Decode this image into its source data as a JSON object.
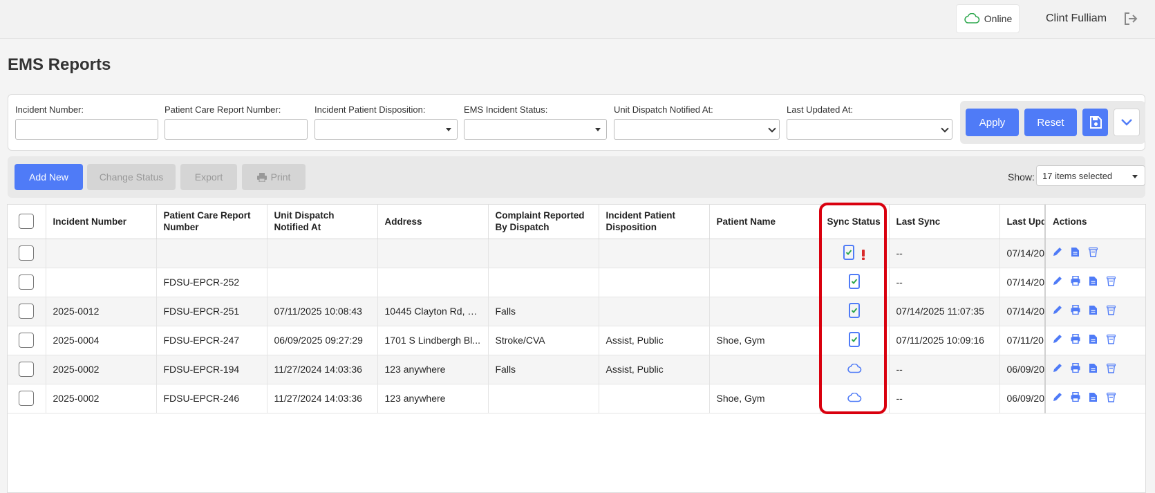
{
  "header": {
    "online_label": "Online",
    "user_name": "Clint Fulliam"
  },
  "page": {
    "title": "EMS Reports"
  },
  "filters": {
    "incident_number_label": "Incident Number:",
    "pcr_number_label": "Patient Care Report Number:",
    "disposition_label": "Incident Patient Disposition:",
    "status_label": "EMS Incident Status:",
    "unit_dispatch_label": "Unit Dispatch Notified At:",
    "last_updated_label": "Last Updated At:",
    "apply_label": "Apply",
    "reset_label": "Reset"
  },
  "toolbar": {
    "add_new_label": "Add New",
    "change_status_label": "Change Status",
    "export_label": "Export",
    "print_label": "Print",
    "show_label": "Show:",
    "show_value": "17 items selected"
  },
  "table": {
    "columns": [
      "Incident Number",
      "Patient Care Report Number",
      "Unit Dispatch Notified At",
      "Address",
      "Complaint Reported By Dispatch",
      "Incident Patient Disposition",
      "Patient Name",
      "Sync Status",
      "Last Sync",
      "Last Upd",
      "Actions"
    ],
    "rows": [
      {
        "incident": "",
        "pcr": "",
        "dispatch": "",
        "address": "",
        "complaint": "",
        "disposition": "",
        "patient": "",
        "sync": "device-check-warning",
        "last_sync": "--",
        "last_updated": "07/14/20",
        "actions": [
          "edit",
          "document",
          "delete"
        ]
      },
      {
        "incident": "",
        "pcr": "FDSU-EPCR-252",
        "dispatch": "",
        "address": "",
        "complaint": "",
        "disposition": "",
        "patient": "",
        "sync": "device-check",
        "last_sync": "--",
        "last_updated": "07/14/20",
        "actions": [
          "edit",
          "print",
          "document",
          "delete"
        ]
      },
      {
        "incident": "2025-0012",
        "pcr": "FDSU-EPCR-251",
        "dispatch": "07/11/2025 10:08:43",
        "address": "10445 Clayton Rd, 6...",
        "complaint": "Falls",
        "disposition": "",
        "patient": "",
        "sync": "device-check",
        "last_sync": "07/14/2025 11:07:35",
        "last_updated": "07/14/20",
        "actions": [
          "edit",
          "print",
          "document",
          "delete"
        ]
      },
      {
        "incident": "2025-0004",
        "pcr": "FDSU-EPCR-247",
        "dispatch": "06/09/2025 09:27:29",
        "address": "1701 S Lindbergh Bl...",
        "complaint": "Stroke/CVA",
        "disposition": "Assist, Public",
        "patient": "Shoe, Gym",
        "sync": "device-check",
        "last_sync": "07/11/2025 10:09:16",
        "last_updated": "07/11/20",
        "actions": [
          "edit",
          "print",
          "document",
          "delete"
        ]
      },
      {
        "incident": "2025-0002",
        "pcr": "FDSU-EPCR-194",
        "dispatch": "11/27/2024 14:03:36",
        "address": "123 anywhere",
        "complaint": "Falls",
        "disposition": "Assist, Public",
        "patient": "",
        "sync": "cloud",
        "last_sync": "--",
        "last_updated": "06/09/20",
        "actions": [
          "edit",
          "print",
          "document",
          "delete"
        ]
      },
      {
        "incident": "2025-0002",
        "pcr": "FDSU-EPCR-246",
        "dispatch": "11/27/2024 14:03:36",
        "address": "123 anywhere",
        "complaint": "",
        "disposition": "",
        "patient": "Shoe, Gym",
        "sync": "cloud",
        "last_sync": "--",
        "last_updated": "06/09/20",
        "actions": [
          "edit",
          "print",
          "document",
          "delete"
        ]
      }
    ]
  },
  "colors": {
    "primary": "#4f7bf7",
    "highlight": "#d9000e",
    "online_cloud": "#2fa84f",
    "warning": "#d92b2b",
    "check": "#2fa84f"
  }
}
